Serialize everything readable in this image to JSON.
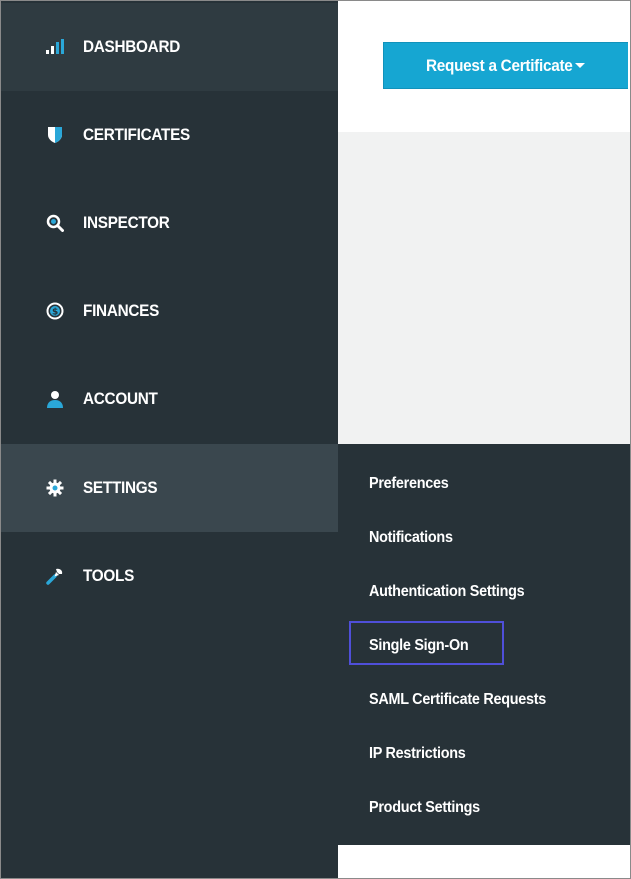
{
  "sidebar": {
    "items": [
      {
        "label": "DASHBOARD",
        "icon": "bar-chart-icon"
      },
      {
        "label": "CERTIFICATES",
        "icon": "shield-icon"
      },
      {
        "label": "INSPECTOR",
        "icon": "magnifier-icon"
      },
      {
        "label": "FINANCES",
        "icon": "dollar-coin-icon"
      },
      {
        "label": "ACCOUNT",
        "icon": "user-icon"
      },
      {
        "label": "SETTINGS",
        "icon": "gear-icon"
      },
      {
        "label": "TOOLS",
        "icon": "wrench-icon"
      }
    ],
    "active": "SETTINGS"
  },
  "header": {
    "request_button_label": "Request a Certificate"
  },
  "settings_menu": {
    "items": [
      "Preferences",
      "Notifications",
      "Authentication Settings",
      "Single Sign-On",
      "SAML Certificate Requests",
      "IP Restrictions",
      "Product Settings"
    ],
    "highlighted": "Single Sign-On"
  },
  "colors": {
    "sidebar_bg": "#273238",
    "sidebar_active_bg": "#3a474e",
    "accent_blue": "#16a6d2",
    "highlight_border": "#4f4fd9",
    "content_bg": "#f1f2f2"
  }
}
